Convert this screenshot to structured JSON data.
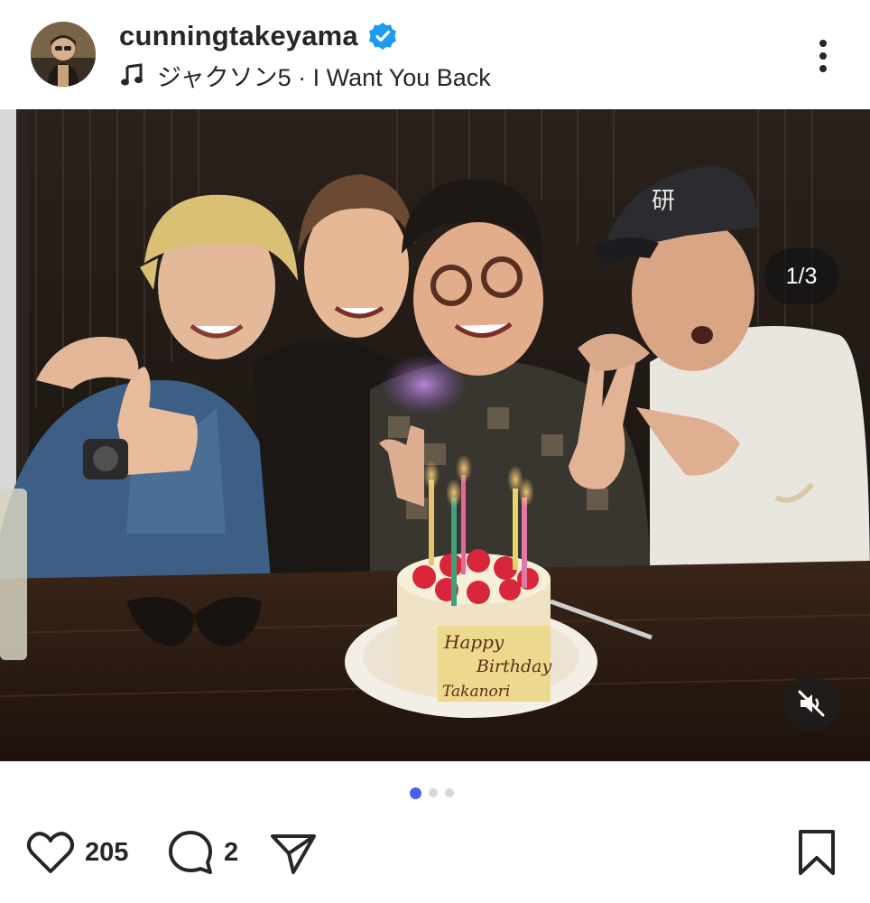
{
  "header": {
    "username": "cunningtakeyama",
    "verified": true,
    "music": "ジャクソン5 · I Want You Back"
  },
  "media": {
    "counter": "1/3",
    "cake_text": [
      "Happy",
      "Birthday",
      "Takanori"
    ],
    "muted": true
  },
  "carousel": {
    "total": 3,
    "active": 1
  },
  "actions": {
    "likes": "205",
    "comments": "2"
  },
  "colors": {
    "verified": "#1d9bf0",
    "active_dot": "#4a5df0",
    "text": "#262626"
  }
}
